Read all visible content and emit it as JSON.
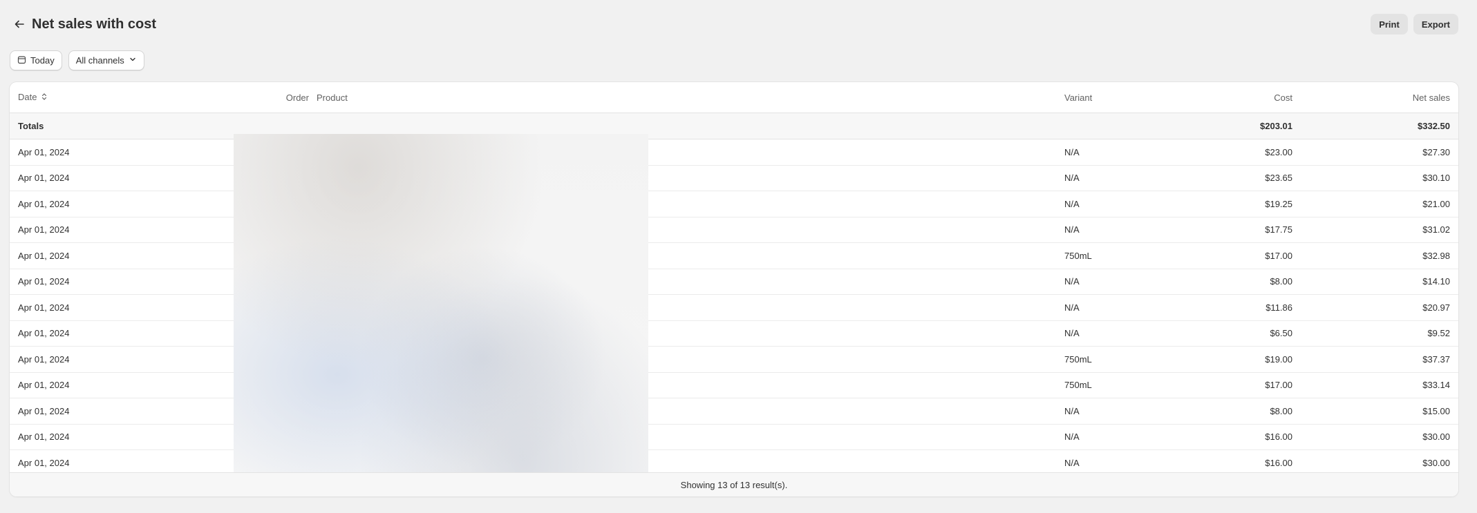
{
  "header": {
    "title": "Net sales with cost",
    "print_label": "Print",
    "export_label": "Export"
  },
  "filters": {
    "date_label": "Today",
    "channel_label": "All channels"
  },
  "table": {
    "columns": {
      "date": "Date",
      "order": "Order",
      "product": "Product",
      "variant": "Variant",
      "cost": "Cost",
      "net_sales": "Net sales"
    },
    "totals": {
      "label": "Totals",
      "cost": "$203.01",
      "net_sales": "$332.50"
    },
    "rows": [
      {
        "date": "Apr 01, 2024",
        "variant": "N/A",
        "cost": "$23.00",
        "net": "$27.30"
      },
      {
        "date": "Apr 01, 2024",
        "variant": "N/A",
        "cost": "$23.65",
        "net": "$30.10"
      },
      {
        "date": "Apr 01, 2024",
        "variant": "N/A",
        "cost": "$19.25",
        "net": "$21.00"
      },
      {
        "date": "Apr 01, 2024",
        "variant": "N/A",
        "cost": "$17.75",
        "net": "$31.02"
      },
      {
        "date": "Apr 01, 2024",
        "variant": "750mL",
        "cost": "$17.00",
        "net": "$32.98"
      },
      {
        "date": "Apr 01, 2024",
        "variant": "N/A",
        "cost": "$8.00",
        "net": "$14.10"
      },
      {
        "date": "Apr 01, 2024",
        "variant": "N/A",
        "cost": "$11.86",
        "net": "$20.97"
      },
      {
        "date": "Apr 01, 2024",
        "variant": "N/A",
        "cost": "$6.50",
        "net": "$9.52"
      },
      {
        "date": "Apr 01, 2024",
        "variant": "750mL",
        "cost": "$19.00",
        "net": "$37.37"
      },
      {
        "date": "Apr 01, 2024",
        "variant": "750mL",
        "cost": "$17.00",
        "net": "$33.14"
      },
      {
        "date": "Apr 01, 2024",
        "variant": "N/A",
        "cost": "$8.00",
        "net": "$15.00"
      },
      {
        "date": "Apr 01, 2024",
        "variant": "N/A",
        "cost": "$16.00",
        "net": "$30.00"
      },
      {
        "date": "Apr 01, 2024",
        "variant": "N/A",
        "cost": "$16.00",
        "net": "$30.00"
      }
    ],
    "footer": "Showing 13 of 13 result(s)."
  }
}
